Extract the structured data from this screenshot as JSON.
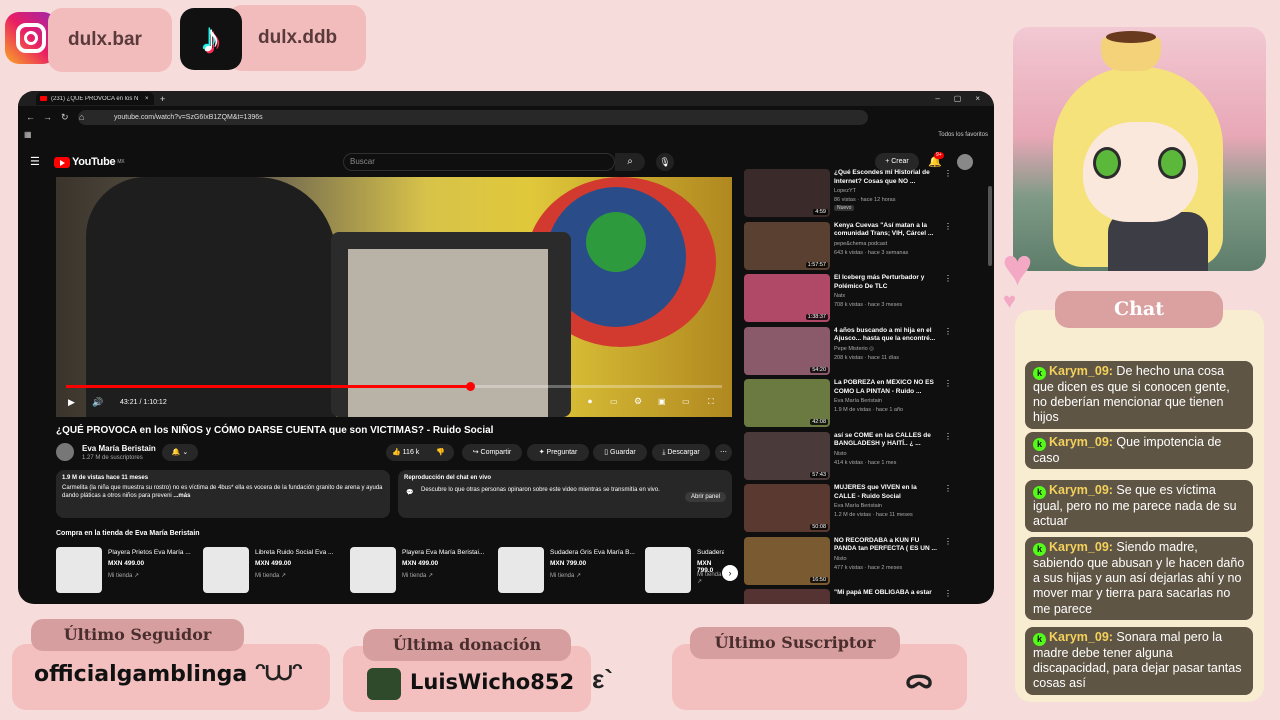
{
  "social": {
    "instagram": {
      "icon": "instagram-icon",
      "handle": "dulx.bar"
    },
    "tiktok": {
      "icon": "tiktok-icon",
      "handle": "dulx.ddb",
      "glyph": "♪"
    }
  },
  "browser": {
    "tab_title": "(231) ¿QUÉ PROVOCA en los N",
    "tab_close": "×",
    "new_tab": "+",
    "url": "youtube.com/watch?v=SzG6IxB1ZQM&t=1396s",
    "bookmarks_label": "Todos los favoritos",
    "window_controls": [
      "–",
      "▢",
      "×"
    ],
    "nav": [
      "←",
      "→",
      "↻",
      "⌂"
    ]
  },
  "youtube": {
    "logo_text": "YouTube",
    "logo_region": "MX",
    "search_placeholder": "Buscar",
    "search_glyph": "⌕",
    "mic_glyph": "🎙",
    "create_label": "+ Crear",
    "notif_count": "9+",
    "menu_glyph": "☰",
    "video": {
      "time": "43:21 / 1:10:12",
      "progress": 0.617,
      "title": "¿QUÉ PROVOCA en los NIÑOS y CÓMO DARSE CUENTA que son VICTIMAS? - Ruido Social",
      "channel": "Eva María Beristain",
      "subs": "1.27 M de suscriptores",
      "likes": "116 k",
      "share": "Compartir",
      "ask": "Preguntar",
      "save": "Guardar",
      "download": "Descargar",
      "desc_stats": "1.9 M de vistas  hace 11 meses",
      "desc_text": "Carmelita (la niña que muestra su rostro) no es víctima de 4bus* ella es vocera de la fundación granito de arena y ayuda dando pláticas a otros niños para preveni",
      "desc_more": "...más",
      "live_title": "Reproducción del chat en vivo",
      "live_text": "Descubre lo que otras personas opinaron sobre este video mientras se transmitía en vivo.",
      "live_open": "Abrir panel"
    },
    "shop": {
      "title": "Compra en la tienda de Eva María Beristain",
      "items": [
        {
          "name": "Playera Prietos Eva María ...",
          "price": "MXN 499.00",
          "store": "Mi tienda ↗"
        },
        {
          "name": "Libreta Ruido Social Eva ...",
          "price": "MXN 499.00",
          "store": "Mi tienda ↗"
        },
        {
          "name": "Playera Eva María Beristai...",
          "price": "MXN 499.00",
          "store": "Mi tienda ↗"
        },
        {
          "name": "Sudadera Gris Eva María B...",
          "price": "MXN 799.00",
          "store": "Mi tienda ↗"
        },
        {
          "name": "Sudadera R",
          "price": "MXN 799.0",
          "store": "Mi tienda ↗"
        }
      ]
    },
    "recommendations": [
      {
        "title": "¿Qué Escondes mi Historial de Internet? Cosas que NO ...",
        "channel": "LopezYT",
        "meta": "86 vistas · hace 12 horas",
        "badge": "Nuevo",
        "duration": "4:59",
        "thumb": "#3a2a2a"
      },
      {
        "title": "Kenya Cuevas \"Así matan a la comunidad Trans; VIH, Cárcel ...",
        "channel": "pepe&chema podcast",
        "meta": "643 k vistas · hace 3 semanas",
        "badge": "",
        "duration": "1:57:57",
        "thumb": "#5a4030"
      },
      {
        "title": "El Iceberg más Perturbador y Polémico De TLC",
        "channel": "Natx",
        "meta": "708 k vistas · hace 3 meses",
        "badge": "",
        "duration": "1:38:37",
        "thumb": "#b04868"
      },
      {
        "title": "4 años buscando a mi hija en el Ajusco... hasta que la encontré...",
        "channel": "Pepe Misterio ◎",
        "meta": "208 k vistas · hace 11 días",
        "badge": "",
        "duration": "54:20",
        "thumb": "#8a5a6a"
      },
      {
        "title": "La POBREZA en MÉXICO NO ES COMO LA PINTAN - Ruido ...",
        "channel": "Eva María Beristain",
        "meta": "1.9 M de vistas · hace 1 año",
        "badge": "",
        "duration": "42:08",
        "thumb": "#6a7a40"
      },
      {
        "title": "así se COME en las CALLES de BANGLADESH y HAITÍ.. ¿ ...",
        "channel": "Nisto",
        "meta": "414 k vistas · hace 1 mes",
        "badge": "",
        "duration": "57:43",
        "thumb": "#4a3a3a"
      },
      {
        "title": "MUJERES que VIVEN en la CALLE - Ruido Social",
        "channel": "Eva María Beristain",
        "meta": "1.2 M de vistas · hace 11 meses",
        "badge": "",
        "duration": "50:08",
        "thumb": "#5a3a30"
      },
      {
        "title": "NO RECORDABA a KUN FU PANDA tan PERFECTA ( ES UN ...",
        "channel": "Nisto",
        "meta": "477 k vistas · hace 2 meses",
        "badge": "",
        "duration": "16:50",
        "thumb": "#7a5a30"
      },
      {
        "title": "\"Mi papá ME OBLIGABA a estar",
        "channel": "",
        "meta": "",
        "badge": "",
        "duration": "",
        "thumb": "#553333"
      }
    ]
  },
  "chat": {
    "header": "Chat",
    "messages": [
      {
        "user": "Karym_09:",
        "text": "De hecho una cosa que dicen es que si conocen gente, no deberían mencionar que tienen hijos"
      },
      {
        "user": "Karym_09:",
        "text": "Que impotencia de caso"
      },
      {
        "user": "Karym_09:",
        "text": "Se que es víctima igual, pero no me parece nada de su actuar"
      },
      {
        "user": "Karym_09:",
        "text": "Siendo madre, sabiendo que abusan y le hacen daño a sus hijas y aun así dejarlas ahí y no mover mar y tierra para sacarlas no me parece"
      },
      {
        "user": "Karym_09:",
        "text": "Sonara mal pero la madre debe tener alguna discapacidad, para dejar pasar tantas cosas así"
      }
    ]
  },
  "widgets": {
    "follower": {
      "label": "Último Seguidor",
      "value": "officialgamblinga",
      "kaomoji": "ᵔ⩊ᵔ"
    },
    "donation": {
      "label": "Última donación",
      "value": "LuisWicho852",
      "kaomoji": "ε`"
    },
    "subscriber": {
      "label": "Último Suscriptor",
      "value": "",
      "kaomoji": "ᯅ"
    }
  }
}
